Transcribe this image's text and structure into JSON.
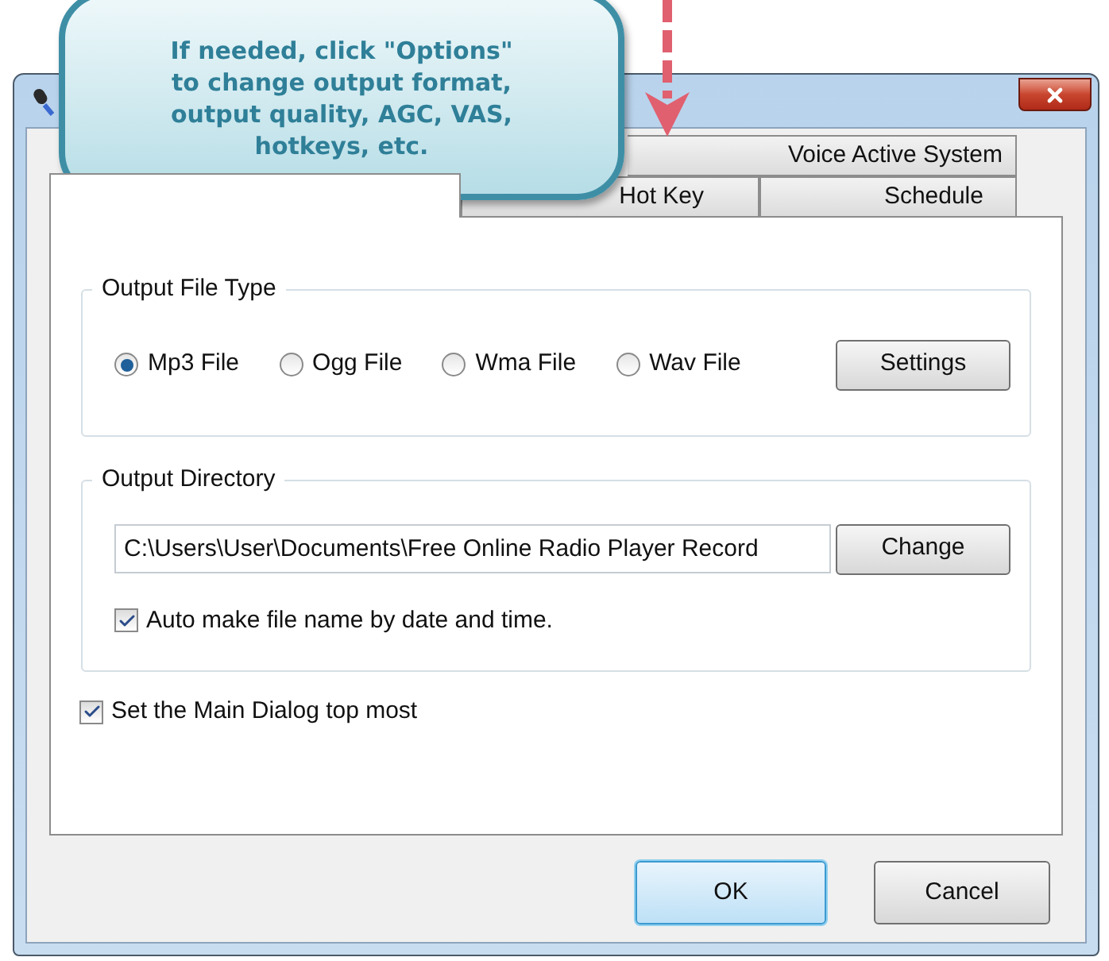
{
  "callout": {
    "lines": [
      "If needed, click \"Options\"",
      "to change output format,",
      "output quality, AGC, VAS,",
      "hotkeys, etc."
    ]
  },
  "tab_rows": [
    {
      "tabs": [
        {
          "label": "Voice Active System",
          "selected": false
        }
      ]
    },
    {
      "tabs": [
        {
          "selected": true
        },
        {
          "label": "Hot Key",
          "selected": false
        },
        {
          "label": "Schedule",
          "selected": false
        }
      ]
    }
  ],
  "output_file_type": {
    "legend": "Output File Type",
    "options": [
      {
        "label": "Mp3 File",
        "selected": true
      },
      {
        "label": "Ogg File",
        "selected": false
      },
      {
        "label": "Wma File",
        "selected": false
      },
      {
        "label": "Wav File",
        "selected": false
      }
    ],
    "button": "Settings"
  },
  "output_directory": {
    "legend": "Output Directory",
    "path": "C:\\Users\\User\\Documents\\Free Online Radio Player Record",
    "button": "Change",
    "auto_name": {
      "label": "Auto make file name by date and time.",
      "checked": true
    }
  },
  "top_most": {
    "label": "Set the Main Dialog top most",
    "checked": true
  },
  "buttons": [
    {
      "label": "OK",
      "default": true
    },
    {
      "label": "Cancel",
      "default": false
    }
  ]
}
